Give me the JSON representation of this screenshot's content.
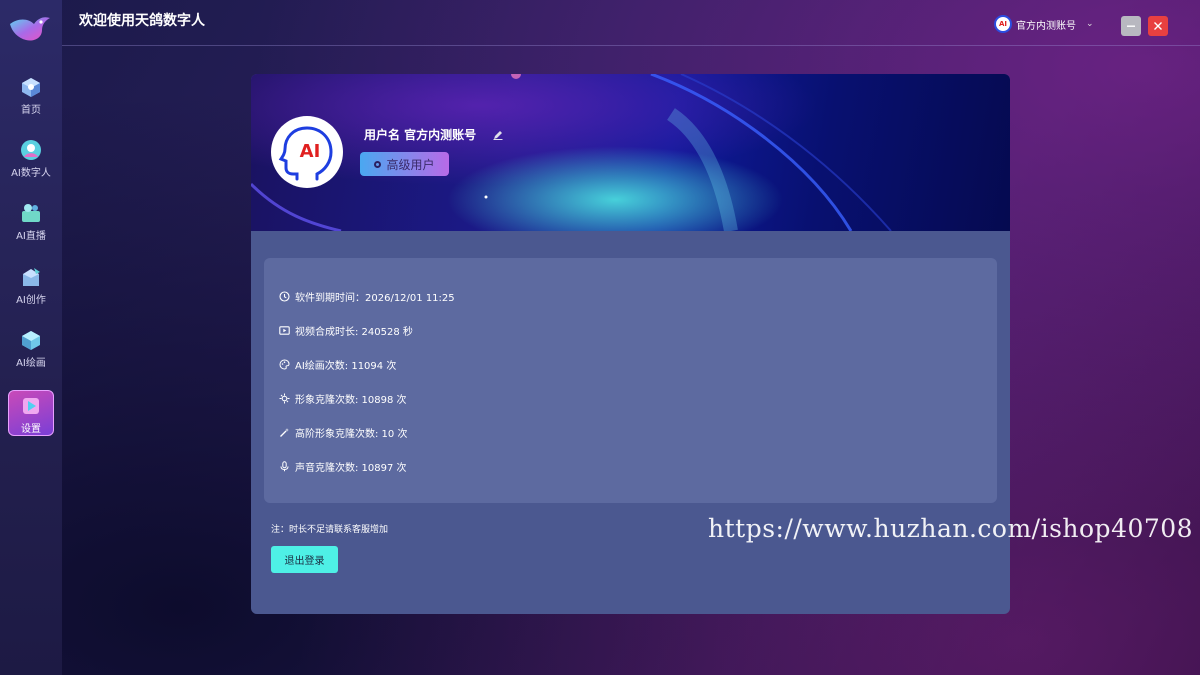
{
  "app": {
    "title": "欢迎使用天鸽数字人"
  },
  "sidebar": {
    "items": [
      {
        "id": "home",
        "label": "首页",
        "icon": "home-cube-icon"
      },
      {
        "id": "ai-digital-human",
        "label": "AI数字人",
        "icon": "digital-human-icon"
      },
      {
        "id": "ai-live",
        "label": "AI直播",
        "icon": "live-stream-icon"
      },
      {
        "id": "ai-create",
        "label": "AI创作",
        "icon": "create-box-icon"
      },
      {
        "id": "ai-draw",
        "label": "AI绘画",
        "icon": "paint-cube-icon"
      },
      {
        "id": "settings",
        "label": "设置",
        "icon": "settings-play-icon",
        "active": true
      }
    ]
  },
  "header": {
    "account_name": "官方内测账号",
    "account_avatar_text": "AI"
  },
  "profile": {
    "username_label": "用户名 官方内测账号",
    "avatar_text": "AI",
    "level": "高级用户"
  },
  "info": {
    "expiry": "软件到期时间：2026/12/01 11:25",
    "video_duration": "视频合成时长: 240528 秒",
    "ai_draw_count": "AI绘画次数: 11094 次",
    "avatar_clone_count": "形象克隆次数: 10898 次",
    "advanced_clone_count": "高阶形象克隆次数: 10 次",
    "voice_clone_count": "声音克隆次数: 10897 次"
  },
  "note": "注：时长不足请联系客服增加",
  "logout_label": "退出登录",
  "watermark": "https://www.huzhan.com/ishop40708",
  "colors": {
    "accent_cyan": "#4ef0e6",
    "close_red": "#e84040",
    "card_bg": "#4b5890",
    "panel_bg": "#5d6aa0"
  }
}
